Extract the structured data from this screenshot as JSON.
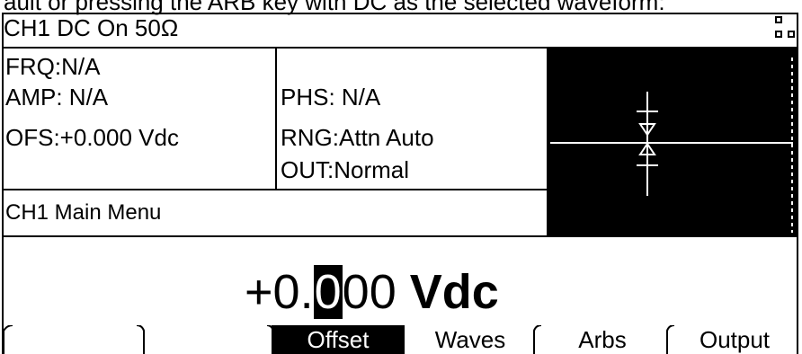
{
  "caption_fragment": "ault or pressing the ARB key with DC as the selected waveform:",
  "header": {
    "title": "CH1   DC On 50Ω"
  },
  "params_left": [
    {
      "text": "FRQ:N/A"
    },
    {
      "text": "AMP: N/A"
    },
    {
      "text": "OFS:+0.000 Vdc"
    }
  ],
  "params_mid": [
    {
      "text": "PHS:  N/A"
    },
    {
      "text": "RNG:Attn Auto"
    },
    {
      "text": "OUT:Normal"
    }
  ],
  "menu": {
    "title": "CH1 Main Menu"
  },
  "value": {
    "sign": "+",
    "int": "0",
    "dot": ".",
    "cursor_digit": "0",
    "rest": "00",
    "unit": "Vdc"
  },
  "softkeys": [
    {
      "label": "",
      "active": false
    },
    {
      "label": "",
      "active": false
    },
    {
      "label": "Offset",
      "active": true
    },
    {
      "label": "Waves",
      "active": false
    },
    {
      "label": "Arbs",
      "active": false
    },
    {
      "label": "Output",
      "active": false
    }
  ],
  "icons": {
    "status": "dual-square-icon",
    "preview": "dc-waveform-preview"
  },
  "colors": {
    "foreground": "#000000",
    "background": "#ffffff"
  }
}
